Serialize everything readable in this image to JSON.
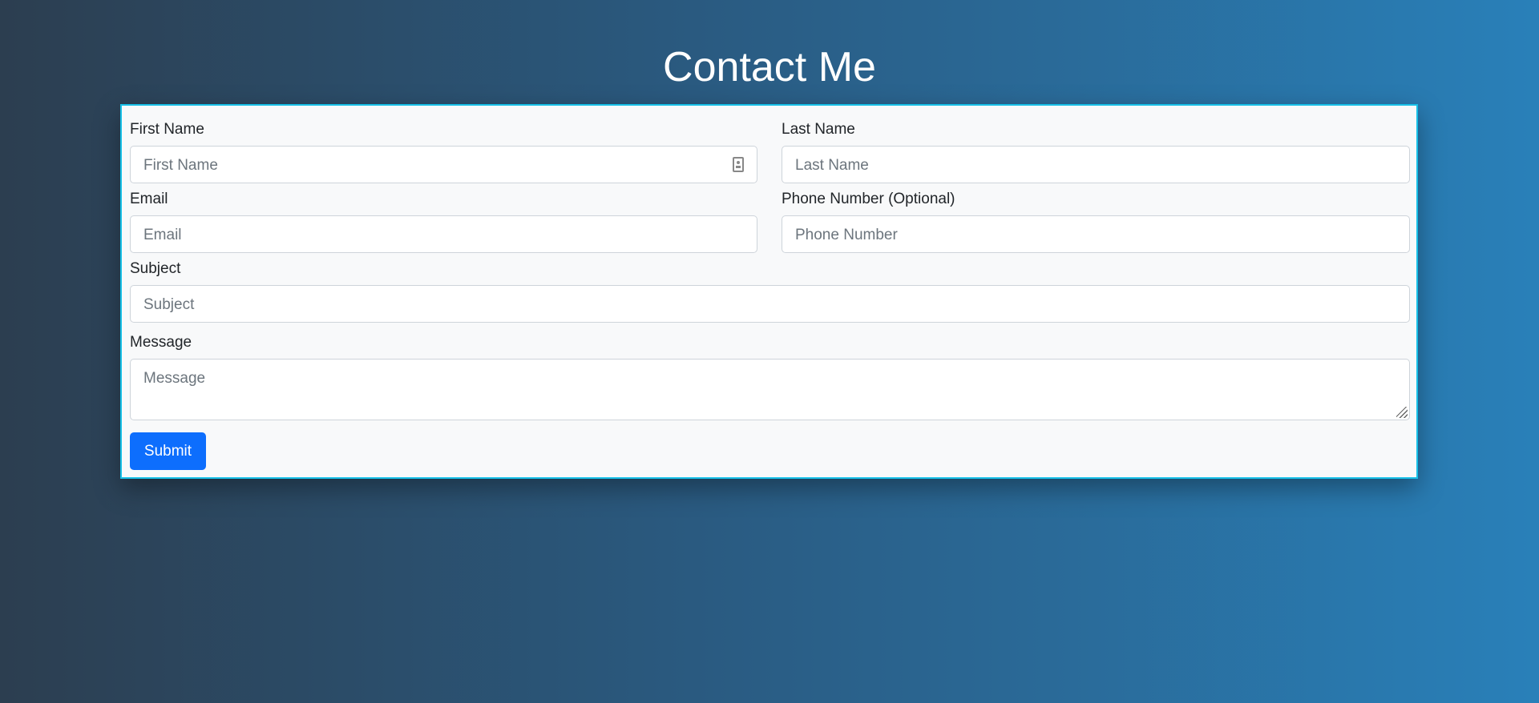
{
  "page": {
    "title": "Contact Me"
  },
  "form": {
    "first_name": {
      "label": "First Name",
      "placeholder": "First Name",
      "value": ""
    },
    "last_name": {
      "label": "Last Name",
      "placeholder": "Last Name",
      "value": ""
    },
    "email": {
      "label": "Email",
      "placeholder": "Email",
      "value": ""
    },
    "phone": {
      "label": "Phone Number (Optional)",
      "placeholder": "Phone Number",
      "value": ""
    },
    "subject": {
      "label": "Subject",
      "placeholder": "Subject",
      "value": ""
    },
    "message": {
      "label": "Message",
      "placeholder": "Message",
      "value": ""
    },
    "submit_label": "Submit",
    "autofill_icon": "contact-card-icon"
  },
  "colors": {
    "background_start": "#2c3e50",
    "background_end": "#2980b9",
    "card_border": "#17c1e8",
    "submit_button": "#0d6efd"
  }
}
